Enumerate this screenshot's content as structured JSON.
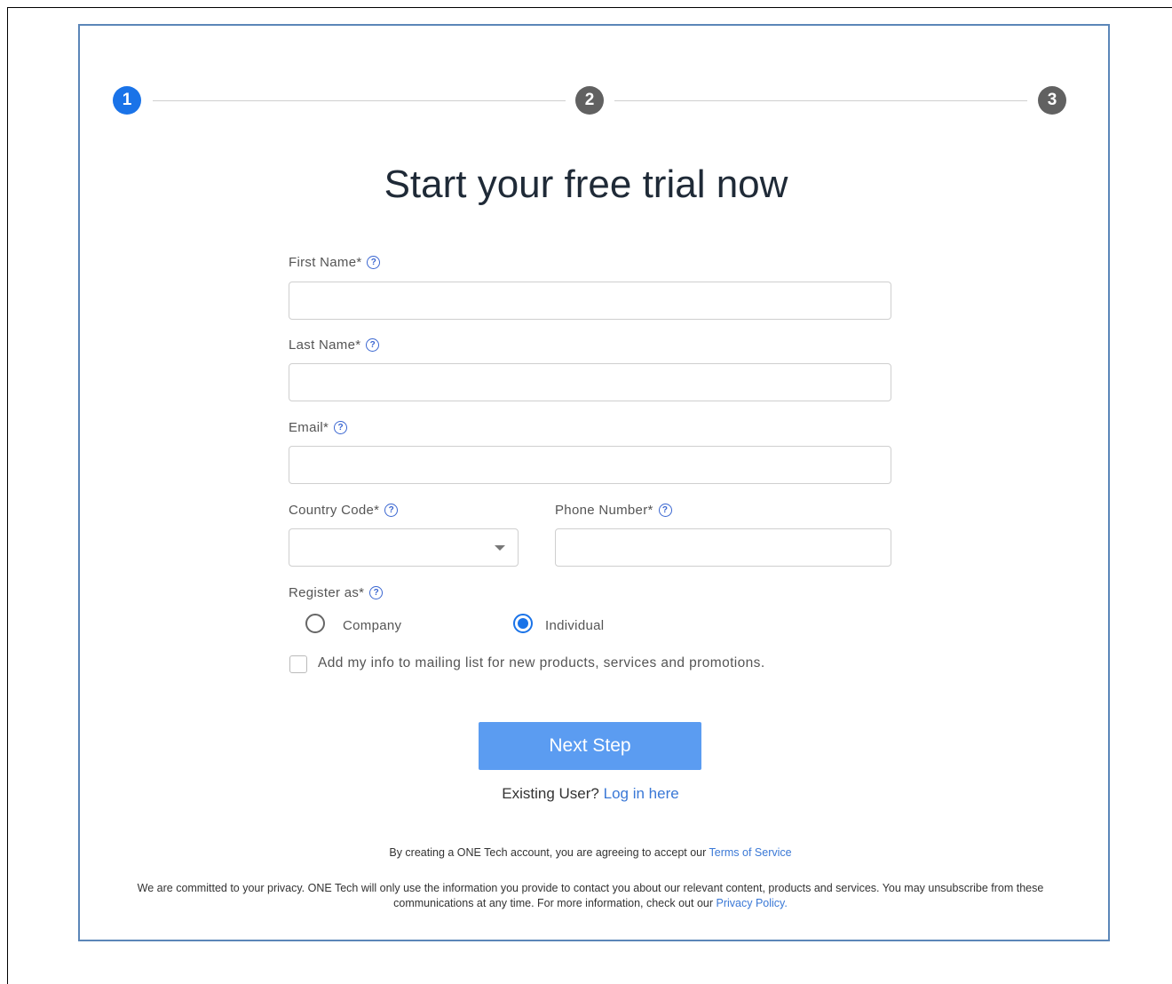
{
  "stepper": {
    "steps": [
      {
        "number": "1",
        "state": "active"
      },
      {
        "number": "2",
        "state": "inactive"
      },
      {
        "number": "3",
        "state": "inactive"
      }
    ]
  },
  "title": "Start your free trial now",
  "form": {
    "first_name": {
      "label": "First Name*",
      "value": ""
    },
    "last_name": {
      "label": "Last Name*",
      "value": ""
    },
    "email": {
      "label": "Email*",
      "value": ""
    },
    "country_code": {
      "label": "Country Code*",
      "value": ""
    },
    "phone_number": {
      "label": "Phone Number*",
      "value": ""
    },
    "register_as": {
      "label": "Register as*",
      "options": [
        {
          "label": "Company",
          "selected": false
        },
        {
          "label": "Individual",
          "selected": true
        }
      ]
    },
    "mailing_list": {
      "label": "Add my info to mailing list for new products, services and promotions.",
      "checked": false
    }
  },
  "next_button": "Next Step",
  "existing_user": {
    "text": "Existing User?",
    "link": "Log in here"
  },
  "terms": {
    "text": "By creating a ONE Tech account, you are agreeing to accept our",
    "link": "Terms of Service"
  },
  "privacy": {
    "text": "We are committed to your privacy. ONE Tech will only use the information you provide to contact you about our relevant content, products and services. You may unsubscribe from these communications at any time. For more information, check out our",
    "link": "Privacy Policy."
  },
  "colors": {
    "accent": "#1a73e8",
    "button": "#5b9cf1",
    "link": "#3a78d6",
    "frame": "#5b86b8"
  },
  "icons": {
    "help": "question-circle-icon",
    "dropdown": "caret-down-icon"
  }
}
